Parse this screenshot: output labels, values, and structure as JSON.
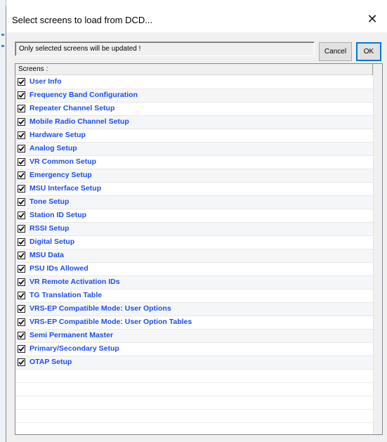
{
  "window": {
    "title": "Select screens to load from DCD...",
    "close_glyph": "✕"
  },
  "message": "Only selected screens will be updated !",
  "buttons": {
    "cancel": "Cancel",
    "ok": "OK"
  },
  "list": {
    "header": "Screens :",
    "items": [
      {
        "label": "User Info",
        "checked": true
      },
      {
        "label": "Frequency Band Configuration",
        "checked": true
      },
      {
        "label": "Repeater Channel Setup",
        "checked": true
      },
      {
        "label": "Mobile Radio Channel Setup",
        "checked": true
      },
      {
        "label": "Hardware Setup",
        "checked": true
      },
      {
        "label": "Analog Setup",
        "checked": true
      },
      {
        "label": "VR Common Setup",
        "checked": true
      },
      {
        "label": "Emergency Setup",
        "checked": true
      },
      {
        "label": "MSU Interface Setup",
        "checked": true
      },
      {
        "label": "Tone Setup",
        "checked": true
      },
      {
        "label": "Station ID Setup",
        "checked": true
      },
      {
        "label": "RSSI Setup",
        "checked": true
      },
      {
        "label": "Digital Setup",
        "checked": true
      },
      {
        "label": "MSU Data",
        "checked": true
      },
      {
        "label": "PSU IDs Allowed",
        "checked": true
      },
      {
        "label": "VR Remote Activation IDs",
        "checked": true
      },
      {
        "label": "TG Translation Table",
        "checked": true
      },
      {
        "label": "VRS-EP Compatible Mode: User Options",
        "checked": true
      },
      {
        "label": "VRS-EP Compatible Mode: User Option Tables",
        "checked": true
      },
      {
        "label": "Semi Permanent Master",
        "checked": true
      },
      {
        "label": "Primary/Secondary Setup",
        "checked": true
      },
      {
        "label": "OTAP Setup",
        "checked": true
      }
    ]
  },
  "colors": {
    "item_text": "#1a4ef0",
    "dialog_bg": "#f0f0f0"
  }
}
